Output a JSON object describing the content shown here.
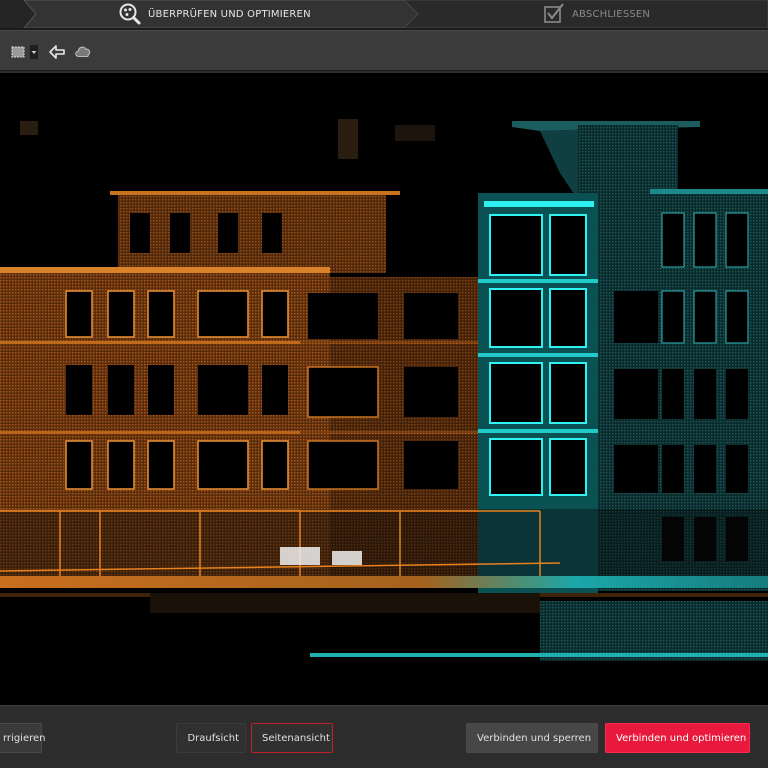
{
  "stepper": {
    "steps": [
      {
        "label": "ÜBERPRÜFEN UND OPTIMIEREN",
        "state": "active",
        "icon": "inspect-icon"
      },
      {
        "label": "ABSCHLIESSEN",
        "state": "inactive",
        "icon": "checkbox-icon"
      }
    ]
  },
  "toolbar": {
    "tools": [
      {
        "name": "selection-icon"
      },
      {
        "name": "dropdown-icon"
      },
      {
        "name": "back-arrow-icon"
      },
      {
        "name": "cloud-icon"
      }
    ]
  },
  "bottom_bar": {
    "korrigieren_label": "rrigieren",
    "draufsicht_label": "Draufsicht",
    "seitenansicht_label": "Seitenansicht",
    "sperren_label": "Verbinden und sperren",
    "optimieren_label": "Verbinden und optimieren"
  },
  "colors": {
    "accent_red": "#e8193c",
    "scan_orange": "#e07a1f",
    "scan_cyan": "#1fe0e0",
    "scan_teal": "#2a8a8c",
    "background": "#000000"
  }
}
